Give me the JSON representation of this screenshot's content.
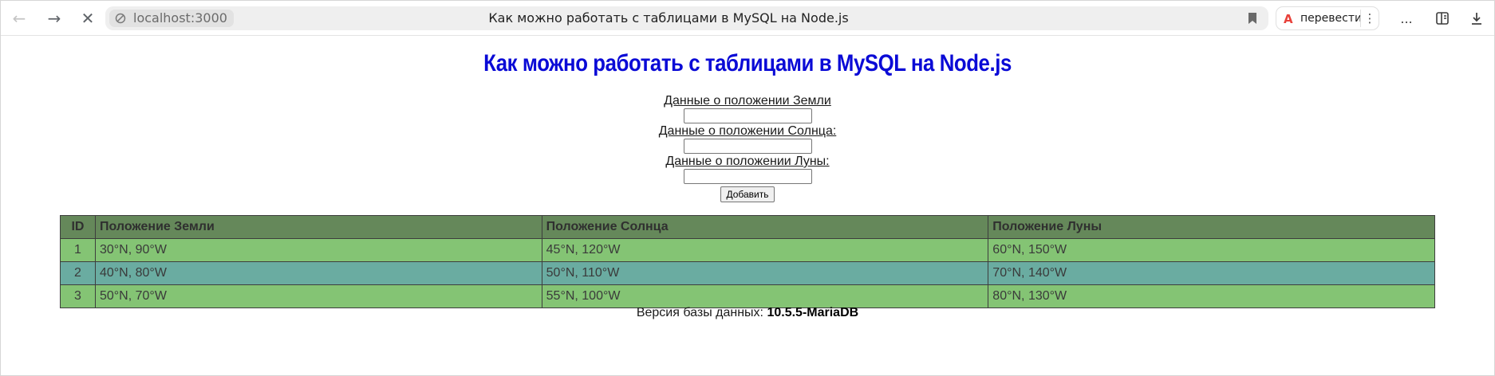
{
  "browser": {
    "url": "localhost:3000",
    "tab_title": "Как можно работать с таблицами в MySQL на Node.js",
    "translate_label": "перевести",
    "menu_dots": "⋮",
    "more_dots": "..."
  },
  "page": {
    "title": "Как можно работать с таблицами в MySQL на Node.js",
    "form": {
      "earth_label": "Данные о положении Земли",
      "sun_label": "Данные о положении Солнца:",
      "moon_label": "Данные о положении Луны:",
      "earth_value": "",
      "sun_value": "",
      "moon_value": "",
      "add_button": "Добавить"
    },
    "table": {
      "headers": [
        "ID",
        "Положение Земли",
        "Положение Солнца",
        "Положение Луны"
      ],
      "rows": [
        [
          "1",
          "30°N, 90°W",
          "45°N, 120°W",
          "60°N, 150°W"
        ],
        [
          "2",
          "40°N, 80°W",
          "50°N, 110°W",
          "70°N, 140°W"
        ],
        [
          "3",
          "50°N, 70°W",
          "55°N, 100°W",
          "80°N, 130°W"
        ]
      ]
    },
    "db_version_label": "Версия базы данных:",
    "db_version_value": "10.5.5-MariaDB"
  },
  "colors": {
    "title": "#0a0ad6",
    "header_bg": "#65885a",
    "row_green": "#84c474",
    "row_teal": "#6aaca1"
  }
}
